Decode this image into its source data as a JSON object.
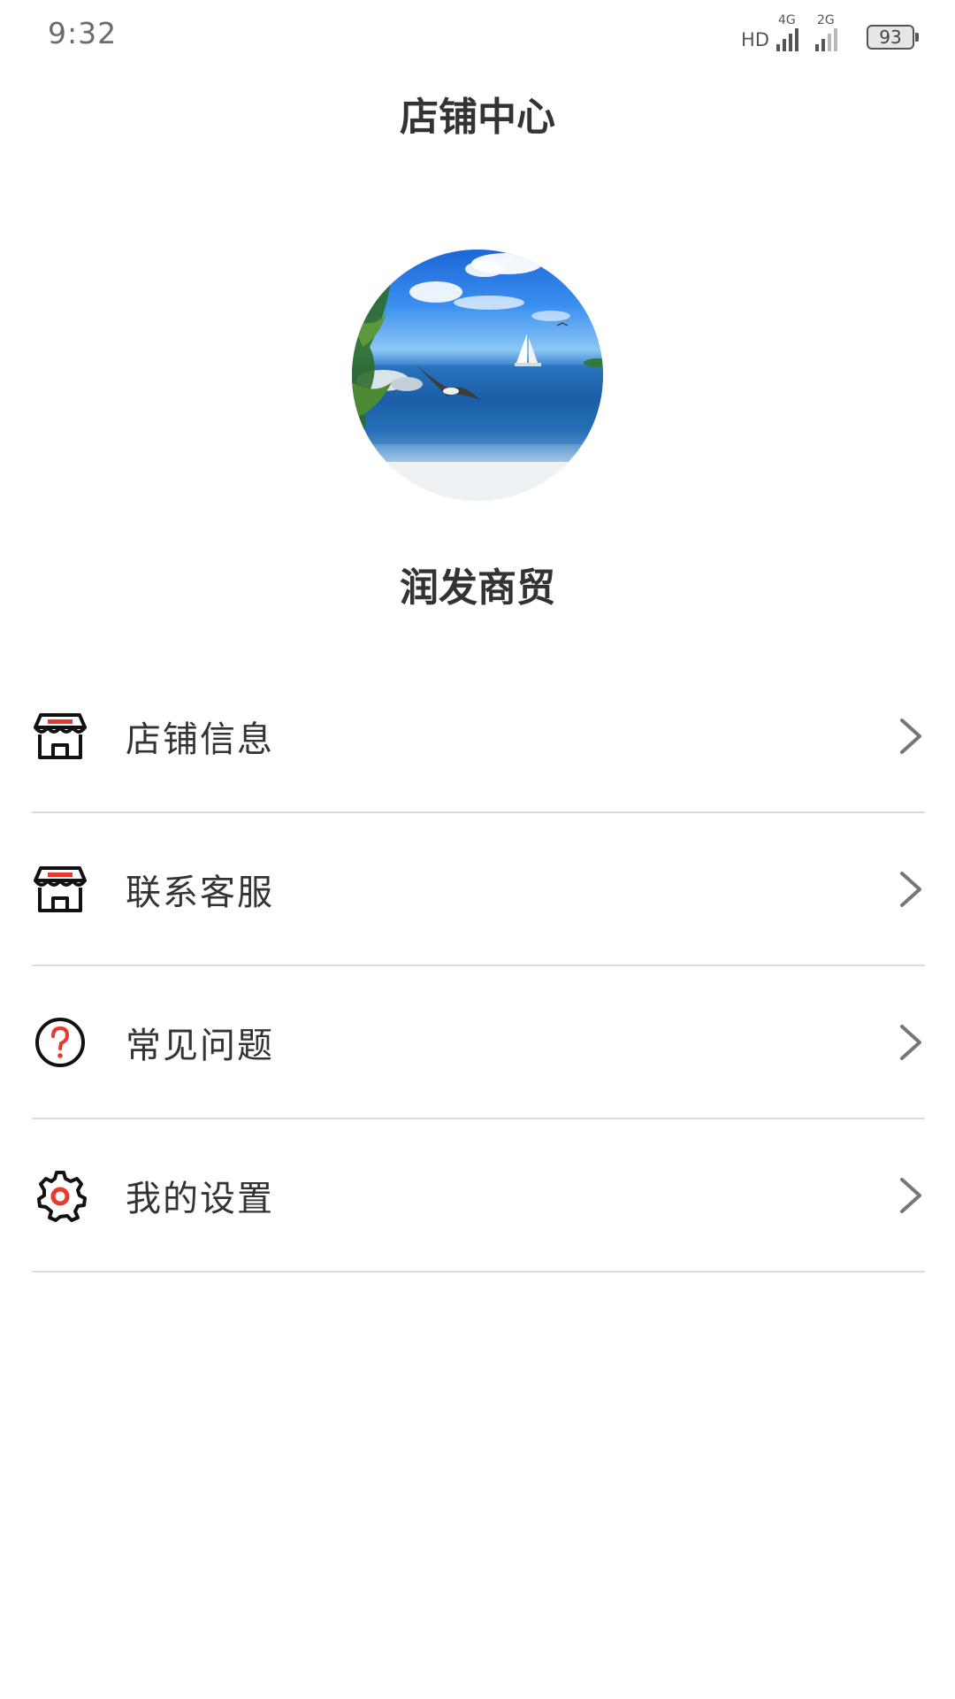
{
  "status_bar": {
    "time": "9:32",
    "network_label": "HD",
    "signal_1_label": "4G",
    "signal_2_label": "2G",
    "battery_level": "93"
  },
  "header": {
    "title": "店铺中心"
  },
  "profile": {
    "shop_name": "润发商贸"
  },
  "menu": {
    "items": [
      {
        "label": "店铺信息",
        "icon": "store-icon"
      },
      {
        "label": "联系客服",
        "icon": "store-icon"
      },
      {
        "label": "常见问题",
        "icon": "question-circle-icon"
      },
      {
        "label": "我的设置",
        "icon": "gear-icon"
      }
    ]
  },
  "colors": {
    "accent": "#e8392f",
    "text": "#333333",
    "divider": "#dcdcdc"
  }
}
